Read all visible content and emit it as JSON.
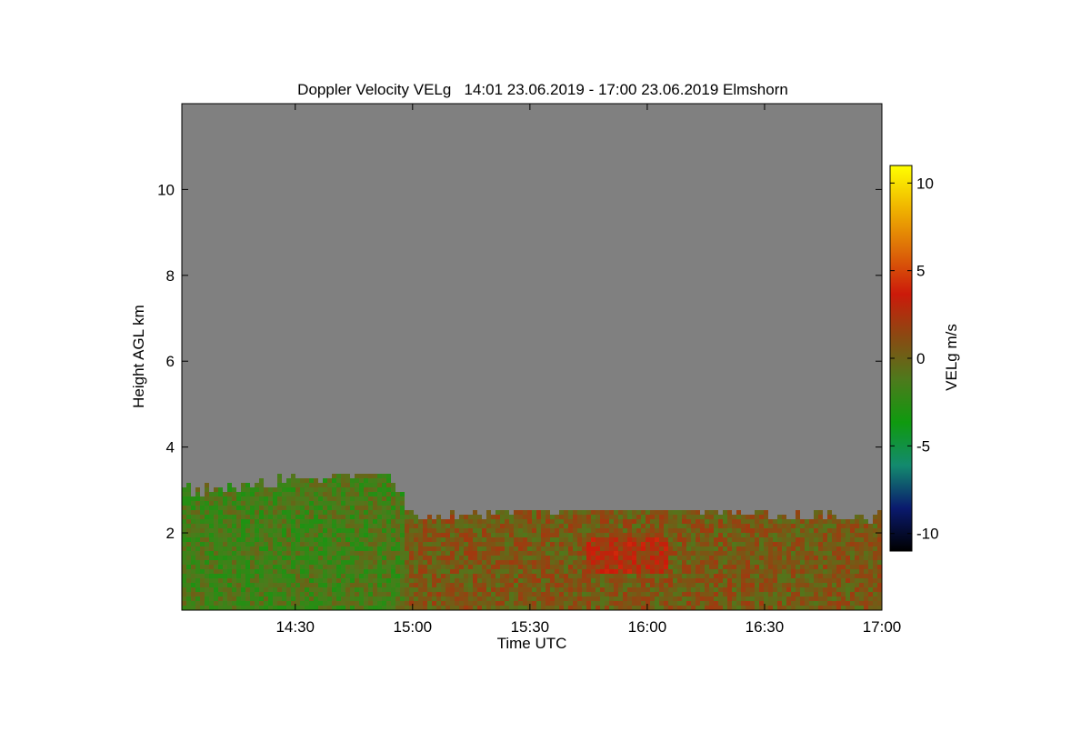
{
  "chart_data": {
    "type": "heatmap",
    "title": "Doppler Velocity VELg   14:01 23.06.2019 - 17:00 23.06.2019 Elmshorn",
    "xlabel": "Time UTC",
    "ylabel": "Height AGL km",
    "xlim": [
      "14:01",
      "17:00"
    ],
    "ylim": [
      0.2,
      12.0
    ],
    "x_ticks": [
      "14:30",
      "15:00",
      "15:30",
      "16:00",
      "16:30",
      "17:00"
    ],
    "y_ticks": [
      2,
      4,
      6,
      8,
      10
    ],
    "colorbar": {
      "label": "VELg m/s",
      "range": [
        -11,
        11
      ],
      "ticks": [
        10,
        5,
        0,
        -5,
        -10
      ],
      "colors": [
        "#000000",
        "#0a1a6e",
        "#138a6e",
        "#0f9a0f",
        "#4d7a1c",
        "#8a4a12",
        "#cc1a0a",
        "#dd6a08",
        "#f0b400",
        "#ffff00"
      ]
    },
    "background_color": "#808080",
    "echo_top_km": [
      {
        "time": "14:01",
        "top": 3.0
      },
      {
        "time": "14:15",
        "top": 3.1
      },
      {
        "time": "14:30",
        "top": 3.3
      },
      {
        "time": "14:40",
        "top": 3.4
      },
      {
        "time": "14:50",
        "top": 3.5
      },
      {
        "time": "14:55",
        "top": 3.3
      },
      {
        "time": "15:00",
        "top": 2.4
      },
      {
        "time": "15:30",
        "top": 2.6
      },
      {
        "time": "16:00",
        "top": 2.7
      },
      {
        "time": "16:30",
        "top": 2.5
      },
      {
        "time": "17:00",
        "top": 2.4
      }
    ],
    "velocity_regions": [
      {
        "start": "14:01",
        "end": "14:58",
        "bottom": 0.2,
        "top": 3.4,
        "mean_velocity": -1.5
      },
      {
        "start": "14:58",
        "end": "17:00",
        "bottom": 0.2,
        "top": 2.5,
        "mean_velocity": 0.5
      },
      {
        "start": "15:45",
        "end": "16:05",
        "bottom": 1.0,
        "top": 1.9,
        "mean_velocity": 2.5
      }
    ]
  }
}
